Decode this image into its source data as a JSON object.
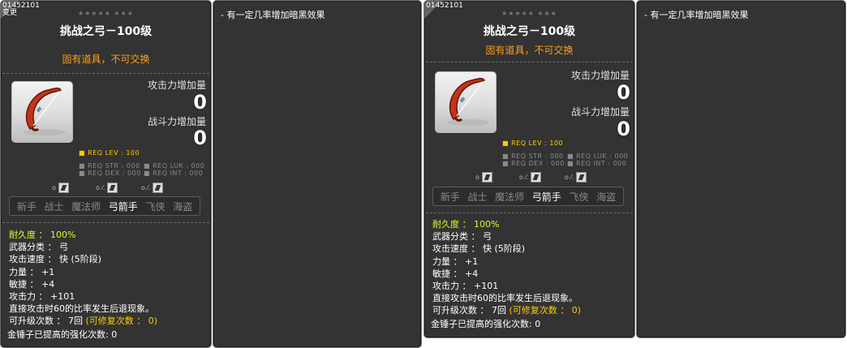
{
  "item": {
    "id": "01452101",
    "sub": "变更",
    "stars": "★★★★★  ★★★",
    "title": "挑战之弓－100级",
    "untradeable": "固有道具，不可交换",
    "attack_increase_label": "攻击力增加量",
    "attack_increase_value": "0",
    "combat_increase_label": "战斗力增加量",
    "combat_increase_value": "0",
    "req_lev": "REQ LEV : 100",
    "req_str": "REQ STR : 000",
    "req_luk": "REQ LUK : 000",
    "req_dex": "REQ DEX : 000",
    "req_int": "REQ INT : 000",
    "elements": [
      "o",
      "o ⁄.",
      "o ⁄."
    ],
    "jobs": [
      "新手",
      "战士",
      "魔法师",
      "弓箭手",
      "飞侠",
      "海盗"
    ],
    "active_job": "弓箭手",
    "durability_label": "耐久度 ： 100%",
    "weapon_type": "武器分类 ： 弓",
    "attack_speed": "攻击速度 ： 快 (5阶段)",
    "str": "力量 ： +1",
    "dex": "敏捷 ： +4",
    "attack": "攻击力 ： +101",
    "knockback": "直接攻击时60的比率发生后退现象。",
    "upgrades_prefix": "可升级次数 ： 7回",
    "upgrades_repair": "(可修复次数 ： 0)",
    "hammer": "金锤子已提高的强化次数: 0"
  },
  "info": {
    "text": "- 有一定几率增加暗黑效果"
  },
  "colors": {
    "panel_bg": "#333333",
    "title": "#ffffff",
    "untradeable": "#ff9e1a",
    "durability": "#d4ff2f",
    "req_lev": "#ffcc00"
  }
}
